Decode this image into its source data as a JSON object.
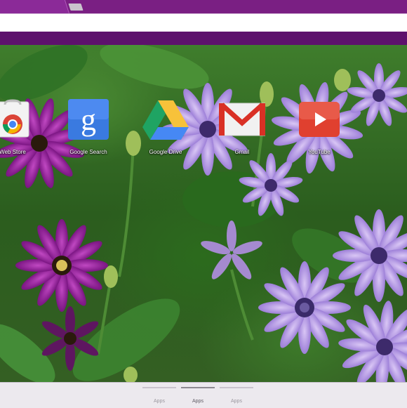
{
  "browser": {
    "tab_title": "",
    "omnibox_value": "",
    "colors": {
      "tabstrip": "#7a1f83",
      "bookmark_bar": "#5d116c",
      "pager": "#ece9ee"
    }
  },
  "apps": [
    {
      "name": "Web Store",
      "icon": "chrome-web-store-icon"
    },
    {
      "name": "Google Search",
      "icon": "google-search-icon"
    },
    {
      "name": "Google Drive",
      "icon": "google-drive-icon"
    },
    {
      "name": "Gmail",
      "icon": "gmail-icon"
    },
    {
      "name": "YouTube",
      "icon": "youtube-icon"
    }
  ],
  "pager": {
    "pages": [
      {
        "label": "Apps",
        "active": false
      },
      {
        "label": "Apps",
        "active": true
      },
      {
        "label": "Apps",
        "active": false
      }
    ]
  }
}
